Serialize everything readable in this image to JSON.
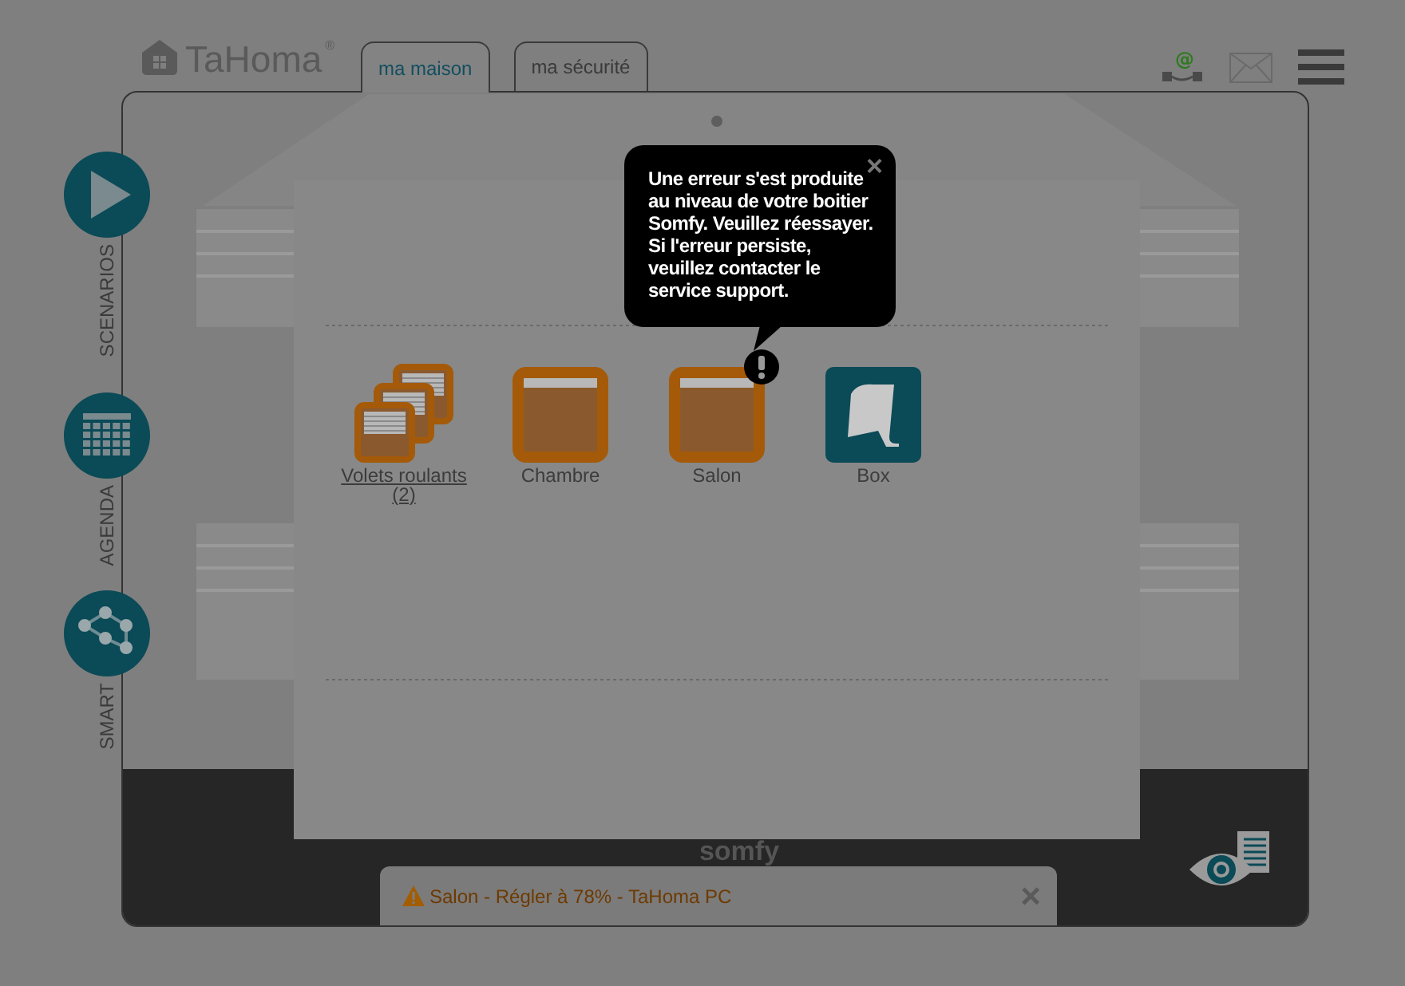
{
  "header": {
    "logo": "TaHoma",
    "logo_mark": "®",
    "at_sign": "@"
  },
  "tabs": [
    {
      "label": "ma maison",
      "selected": true
    },
    {
      "label": "ma sécurité",
      "selected": false
    }
  ],
  "sidebar": [
    {
      "kind": "play",
      "label": "SCENARIOS"
    },
    {
      "kind": "calendar",
      "label": "AGENDA"
    },
    {
      "kind": "network",
      "label": "SMART"
    }
  ],
  "devices": [
    {
      "kind": "group",
      "label": "Volets roulants",
      "count": "(2)",
      "error": false
    },
    {
      "kind": "shutter",
      "label": "Chambre",
      "error": false
    },
    {
      "kind": "shutter",
      "label": "Salon",
      "error": true
    },
    {
      "kind": "box",
      "label": "Box",
      "error": false
    }
  ],
  "tooltip": {
    "text": "Une erreur s'est produite au niveau de votre boitier Somfy. Veuillez réessayer. Si l'erreur persiste, veuillez contacter le service support.",
    "close": "×"
  },
  "footer": {
    "brand": "somfy"
  },
  "notification": {
    "text": "Salon - Régler à 78% - TaHoma PC",
    "close": "×"
  }
}
